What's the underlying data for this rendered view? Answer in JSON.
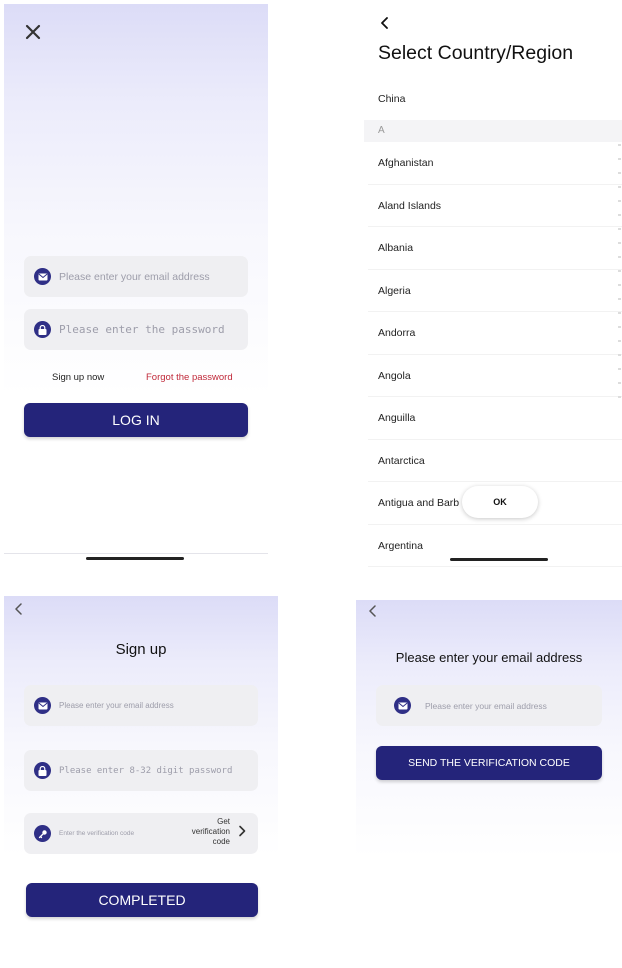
{
  "login": {
    "email_placeholder": "Please enter your email address",
    "password_placeholder": "Please enter the password",
    "signup_link": "Sign up now",
    "forgot_link": "Forgot the password",
    "login_button": "LOG IN"
  },
  "country_picker": {
    "title": "Select Country/Region",
    "pinned": "China",
    "section_letter": "A",
    "countries": [
      "Afghanistan",
      "Aland Islands",
      "Albania",
      "Algeria",
      "Andorra",
      "Angola",
      "Anguilla",
      "Antarctica",
      "Antigua and Barb",
      "Argentina"
    ],
    "ok_button": "OK"
  },
  "signup": {
    "title": "Sign up",
    "email_placeholder": "Please enter your email address",
    "password_placeholder": "Please enter 8-32 digit password",
    "code_placeholder": "Enter the verification code",
    "get_code_line1": "Get",
    "get_code_line2": "verification",
    "get_code_line3": "code",
    "completed_button": "COMPLETED"
  },
  "verify": {
    "title": "Please enter your email address",
    "email_placeholder": "Please enter your email address",
    "send_button": "SEND THE VERIFICATION CODE"
  },
  "colors": {
    "accent": "#24247a",
    "forgot_link": "#c0293a",
    "field_bg": "#efeff2"
  }
}
